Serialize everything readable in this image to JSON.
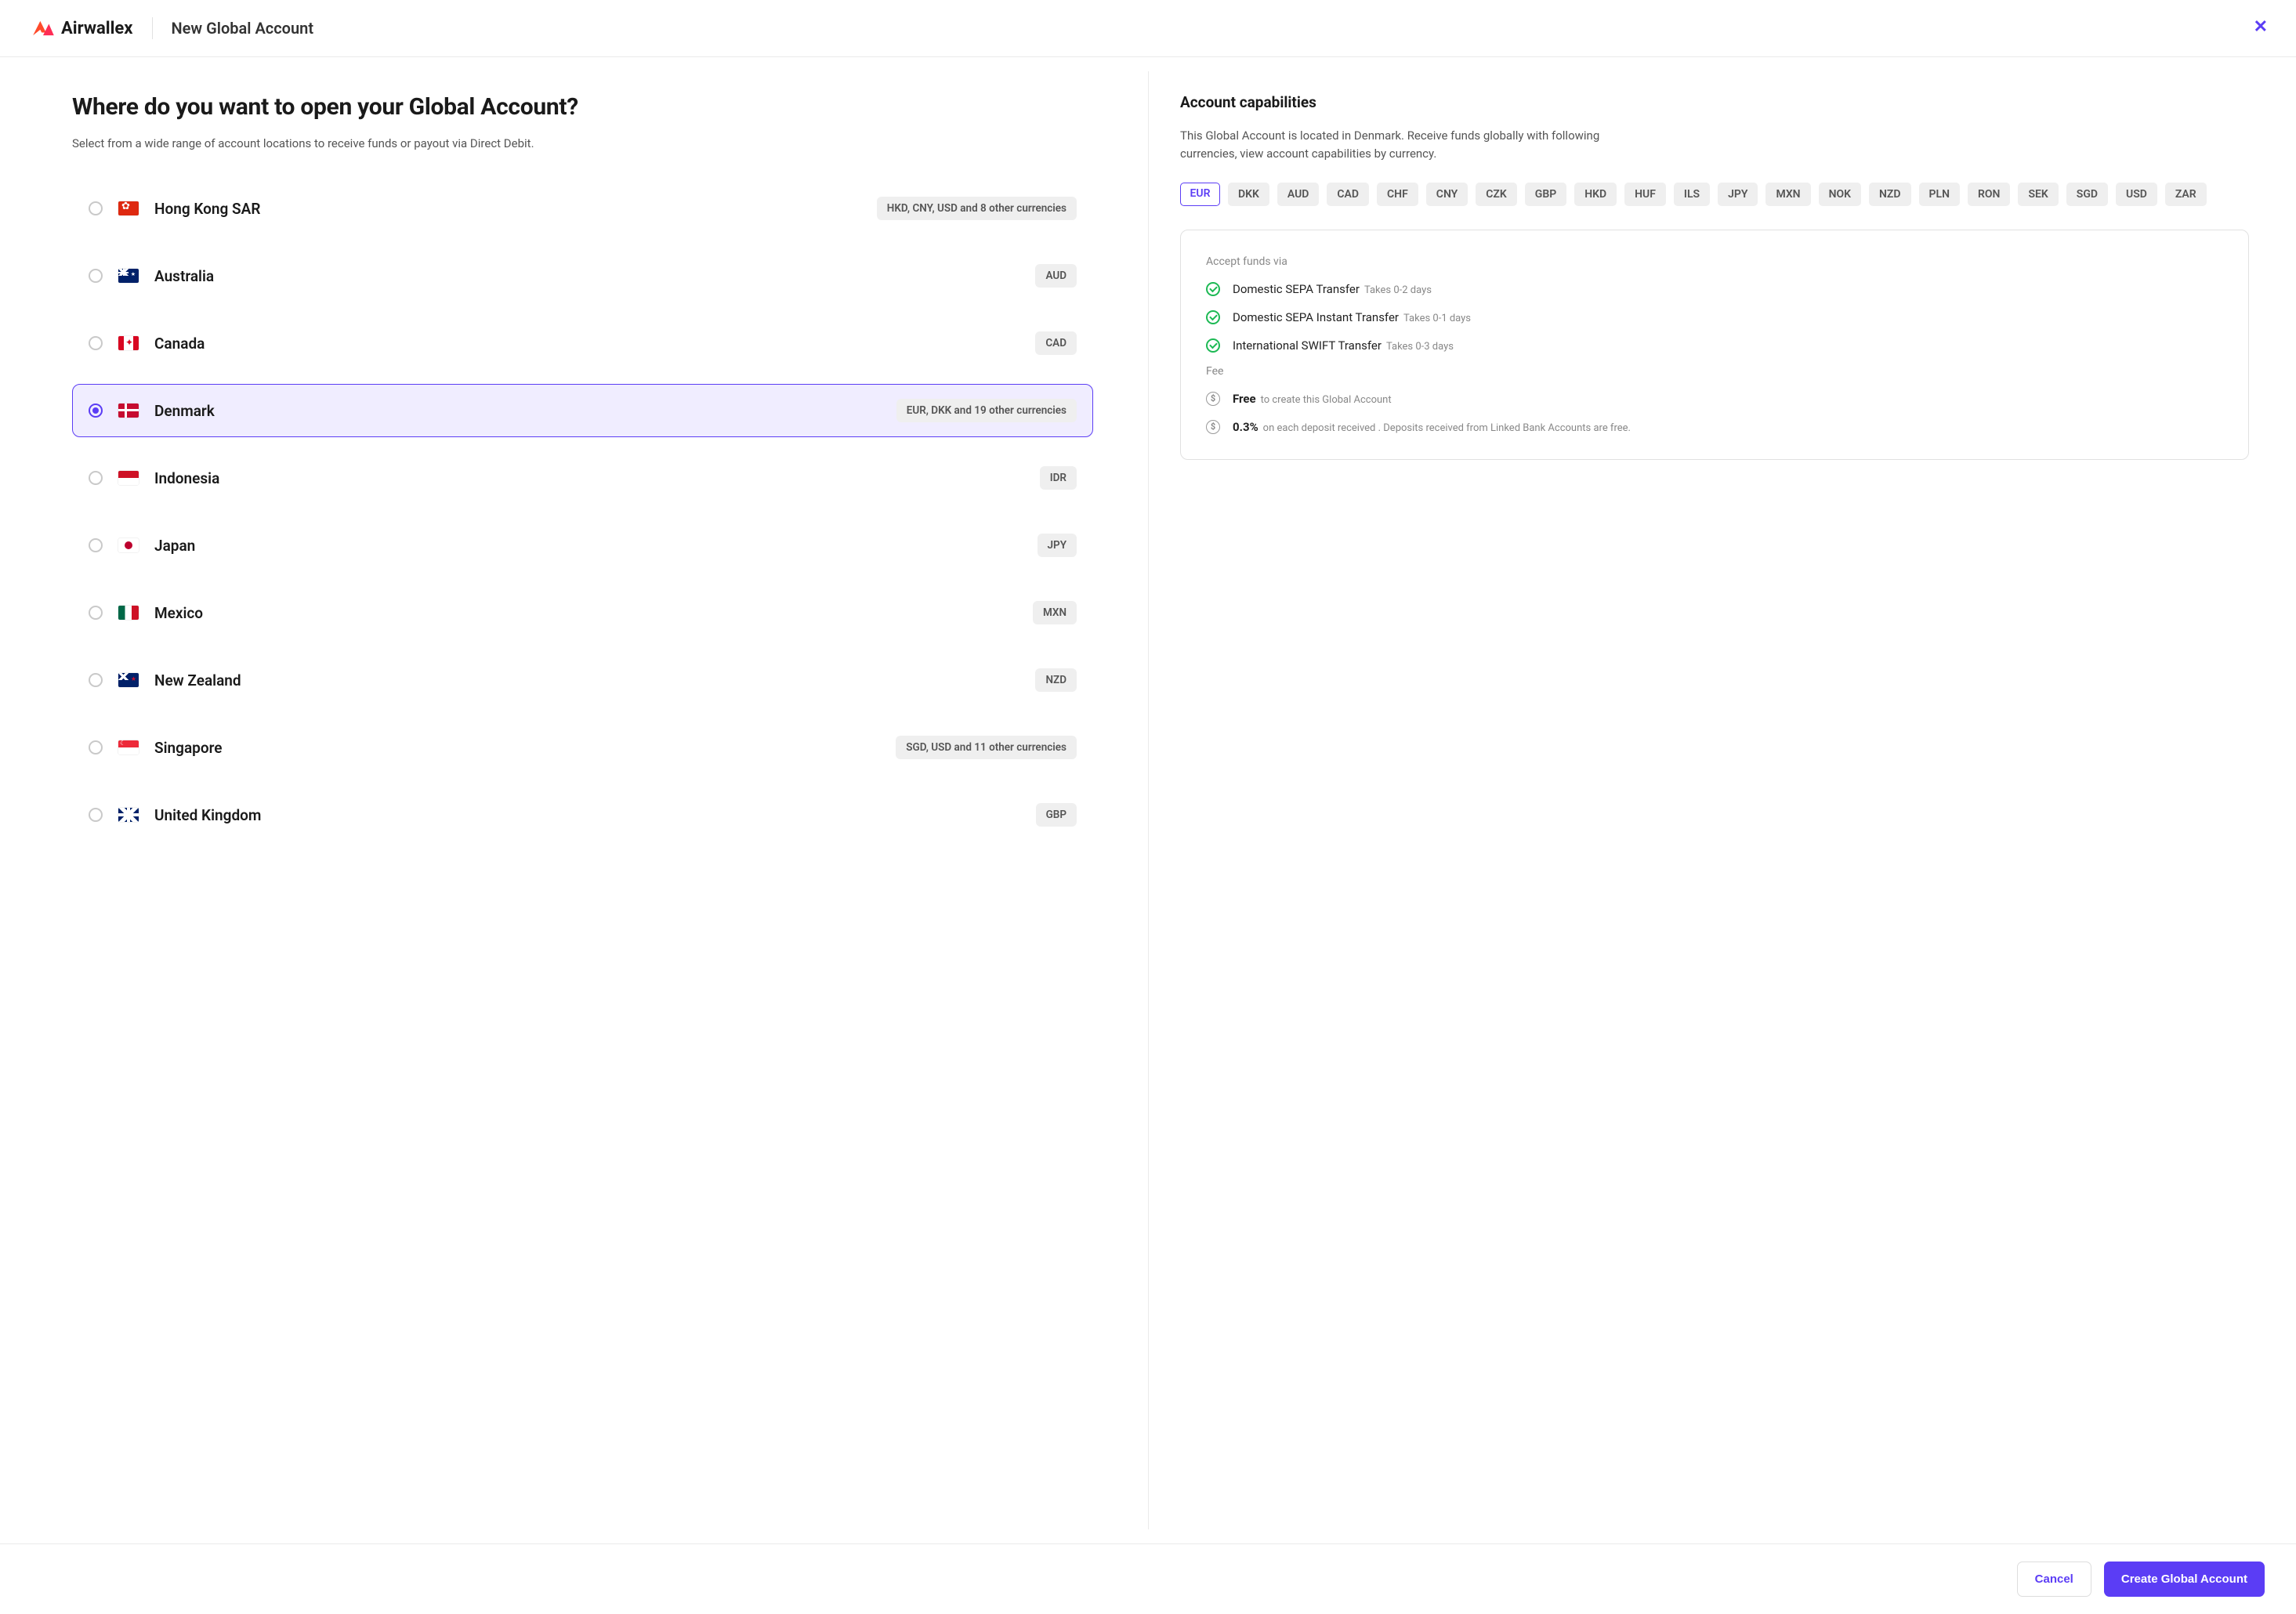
{
  "header": {
    "brand": "Airwallex",
    "title": "New Global Account"
  },
  "left": {
    "heading": "Where do you want to open your Global Account?",
    "subtitle": "Select from a wide range of account locations to receive funds or payout via Direct Debit.",
    "countries": [
      {
        "id": "hk",
        "name": "Hong Kong SAR",
        "badge": "HKD, CNY, USD and 8 other currencies",
        "selected": false,
        "flag": "flag-hk"
      },
      {
        "id": "au",
        "name": "Australia",
        "badge": "AUD",
        "selected": false,
        "flag": "flag-au"
      },
      {
        "id": "ca",
        "name": "Canada",
        "badge": "CAD",
        "selected": false,
        "flag": "flag-ca"
      },
      {
        "id": "dk",
        "name": "Denmark",
        "badge": "EUR, DKK and 19 other currencies",
        "selected": true,
        "flag": "flag-dk"
      },
      {
        "id": "id",
        "name": "Indonesia",
        "badge": "IDR",
        "selected": false,
        "flag": "flag-id"
      },
      {
        "id": "jp",
        "name": "Japan",
        "badge": "JPY",
        "selected": false,
        "flag": "flag-jp"
      },
      {
        "id": "mx",
        "name": "Mexico",
        "badge": "MXN",
        "selected": false,
        "flag": "flag-mx"
      },
      {
        "id": "nz",
        "name": "New Zealand",
        "badge": "NZD",
        "selected": false,
        "flag": "flag-nz"
      },
      {
        "id": "sg",
        "name": "Singapore",
        "badge": "SGD, USD and 11 other currencies",
        "selected": false,
        "flag": "flag-sg"
      },
      {
        "id": "gb",
        "name": "United Kingdom",
        "badge": "GBP",
        "selected": false,
        "flag": "flag-gb"
      }
    ]
  },
  "right": {
    "heading": "Account capabilities",
    "description": "This Global Account is located in Denmark. Receive funds globally with following currencies, view account capabilities by currency.",
    "currencies": [
      {
        "code": "EUR",
        "selected": true
      },
      {
        "code": "DKK",
        "selected": false
      },
      {
        "code": "AUD",
        "selected": false
      },
      {
        "code": "CAD",
        "selected": false
      },
      {
        "code": "CHF",
        "selected": false
      },
      {
        "code": "CNY",
        "selected": false
      },
      {
        "code": "CZK",
        "selected": false
      },
      {
        "code": "GBP",
        "selected": false
      },
      {
        "code": "HKD",
        "selected": false
      },
      {
        "code": "HUF",
        "selected": false
      },
      {
        "code": "ILS",
        "selected": false
      },
      {
        "code": "JPY",
        "selected": false
      },
      {
        "code": "MXN",
        "selected": false
      },
      {
        "code": "NOK",
        "selected": false
      },
      {
        "code": "NZD",
        "selected": false
      },
      {
        "code": "PLN",
        "selected": false
      },
      {
        "code": "RON",
        "selected": false
      },
      {
        "code": "SEK",
        "selected": false
      },
      {
        "code": "SGD",
        "selected": false
      },
      {
        "code": "USD",
        "selected": false
      },
      {
        "code": "ZAR",
        "selected": false
      }
    ],
    "accept_label": "Accept funds via",
    "accept_methods": [
      {
        "name": "Domestic SEPA Transfer",
        "timing": "Takes 0-2 days"
      },
      {
        "name": "Domestic SEPA Instant Transfer",
        "timing": "Takes 0-1 days"
      },
      {
        "name": "International SWIFT Transfer",
        "timing": "Takes 0-3 days"
      }
    ],
    "fee_label": "Fee",
    "fees": [
      {
        "main": "Free",
        "sub": "to create this Global Account"
      },
      {
        "main": "0.3%",
        "sub": "on each deposit received . Deposits received from Linked Bank Accounts are free."
      }
    ]
  },
  "footer": {
    "cancel": "Cancel",
    "submit": "Create Global Account"
  }
}
